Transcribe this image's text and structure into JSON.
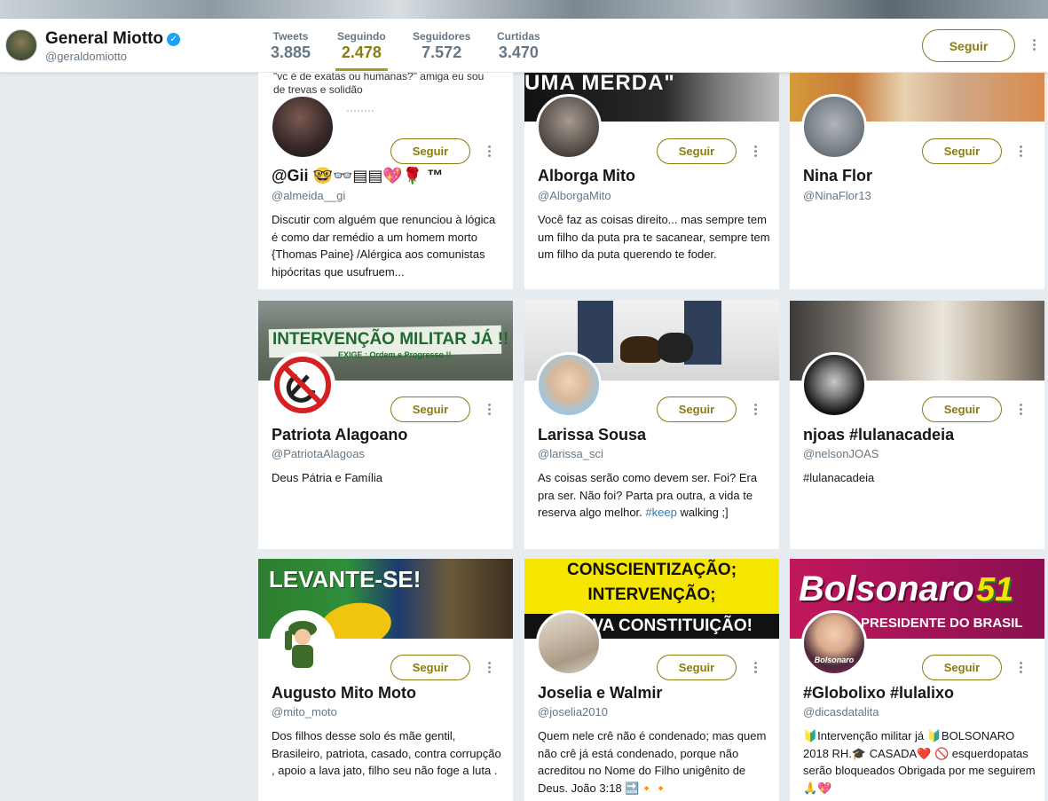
{
  "profile": {
    "name": "General Miotto",
    "handle": "@geraldomiotto",
    "follow_label": "Seguir"
  },
  "stats": [
    {
      "label": "Tweets",
      "value": "3.885"
    },
    {
      "label": "Seguindo",
      "value": "2.478"
    },
    {
      "label": "Seguidores",
      "value": "7.572"
    },
    {
      "label": "Curtidas",
      "value": "3.470"
    }
  ],
  "colors": {
    "accent": "#8a7c13",
    "link": "#2b7bb9",
    "verified": "#1da1f2"
  },
  "cards": [
    {
      "banner_text": "\"vc é de exatas ou humanas?\" amiga eu sou de trevas e solidão",
      "name": "@Gii 🤓👓▤▤💖🌹 ™",
      "handle": "@almeida__gi",
      "bio": "Discutir com alguém que renunciou à lógica é como dar remédio a um homem morto {Thomas Paine} /Alérgica aos comunistas hipócritas que usufruem...",
      "follow": "Seguir"
    },
    {
      "banner_text": "UMA MERDA\"",
      "name": "Alborga Mito",
      "handle": "@AlborgaMito",
      "bio": "Você faz as coisas direito... mas sempre tem um filho da puta pra te sacanear, sempre tem um filho da puta querendo te foder.",
      "follow": "Seguir"
    },
    {
      "name": "Nina Flor",
      "handle": "@NinaFlor13",
      "bio": "",
      "follow": "Seguir"
    },
    {
      "banner_text": "INTERVENÇÃO MILITAR JÁ !!",
      "banner_sub": "EXIGE : Ordem e Progresso !!",
      "name": "Patriota Alagoano",
      "handle": "@PatriotaAlagoas",
      "bio": "Deus Pátria e Família",
      "follow": "Seguir"
    },
    {
      "name": "Larissa Sousa",
      "handle": "@larissa_sci",
      "bio_pre": "As coisas serão como devem ser. Foi? Era pra ser. Não foi? Parta pra outra, a vida te reserva algo melhor. ",
      "bio_hash": "#keep",
      "bio_post": " walking ;]",
      "follow": "Seguir"
    },
    {
      "name": "njoas #lulanacadeia",
      "handle": "@nelsonJOAS",
      "bio_hash": "#lulanacadeia",
      "follow": "Seguir"
    },
    {
      "banner_text": "LEVANTE-SE!",
      "name": "Augusto Mito Moto",
      "handle": "@mito_moto",
      "bio": "Dos filhos desse solo és mãe gentil, Brasileiro, patriota, casado, contra corrupção , apoio a lava jato, filho seu não foge a luta .",
      "follow": "Seguir"
    },
    {
      "banner_line1": "CONSCIENTIZAÇÃO;",
      "banner_line2": "INTERVENÇÃO;",
      "banner_line3": "E NOVA CONSTITUIÇÃO!",
      "name": "Joselia e Walmir",
      "handle": "@joselia2010",
      "bio": "Quem nele crê não é condenado; mas quem não crê já está condenado, porque não acreditou no Nome do Filho unigênito de Deus. João 3:18 🔜🔸🔸",
      "follow": "Seguir"
    },
    {
      "banner_text": "Bolsonaro",
      "banner_num": "51",
      "banner_sub": "PRESIDENTE DO BRASIL",
      "avatar_text": "Bolsonaro",
      "name": "#Globolixo #lulalixo",
      "handle": "@dicasdatalita",
      "bio": "🔰Intervenção militar já 🔰BOLSONARO 2018 RH.🎓 CASADA❤️ 🚫 esquerdopatas serão bloqueados Obrigada por me seguirem🙏💖",
      "follow": "Seguir"
    }
  ]
}
